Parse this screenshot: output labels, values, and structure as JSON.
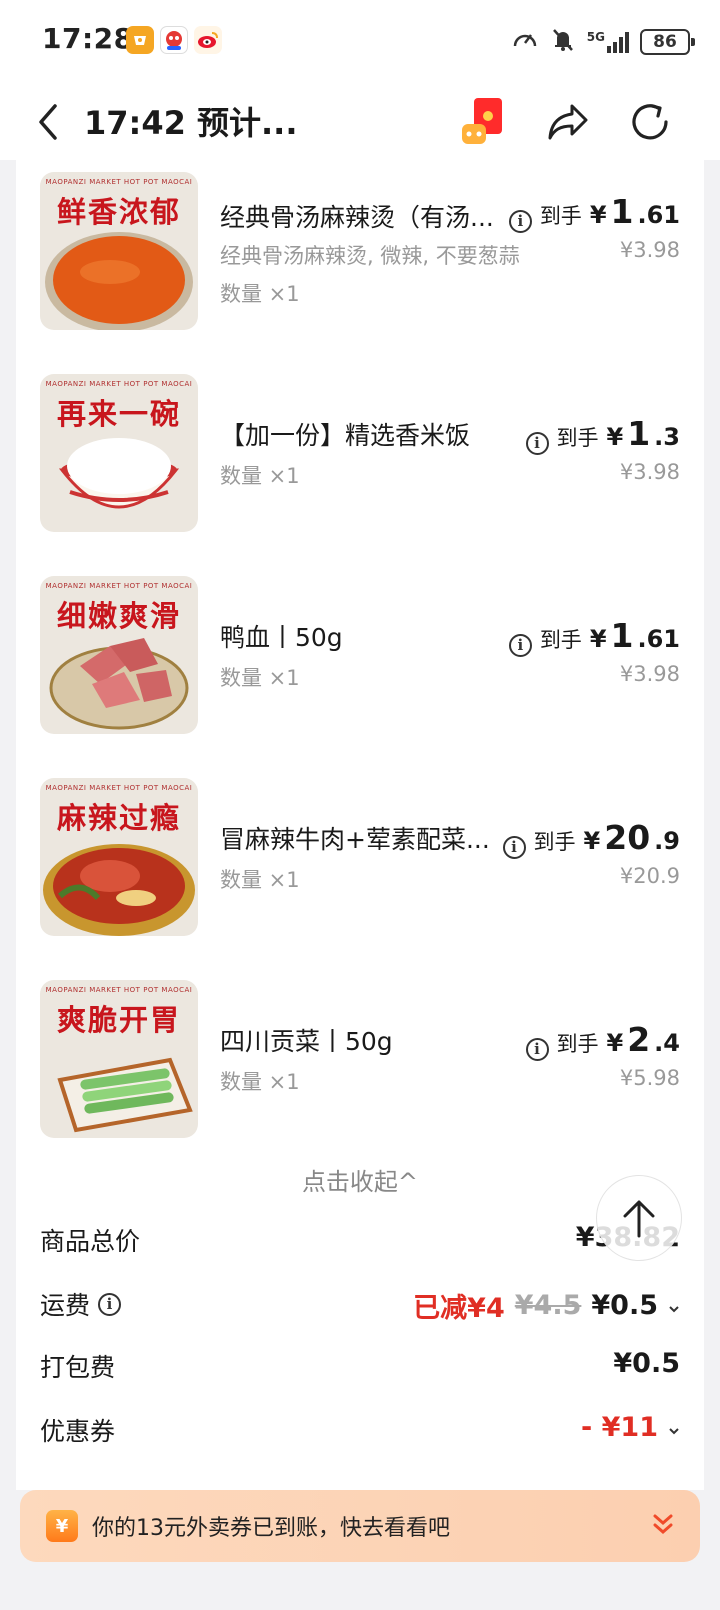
{
  "status_bar": {
    "time": "17:28",
    "network": "5G",
    "battery": "86"
  },
  "header": {
    "title": "17:42 预计..."
  },
  "items": [
    {
      "thumb_label": "鲜香浓郁",
      "name": "经典骨汤麻辣烫（有汤...",
      "spec": "经典骨汤麻辣烫, 微辣, 不要葱蒜",
      "qty": "数量 ×1",
      "arrival_label": "到手",
      "price_yen": "¥",
      "price_int": "1",
      "price_dec": ".61",
      "original_price": "¥3.98"
    },
    {
      "thumb_label": "再来一碗",
      "name": "【加一份】精选香米饭",
      "spec": "",
      "qty": "数量 ×1",
      "arrival_label": "到手",
      "price_yen": "¥",
      "price_int": "1",
      "price_dec": ".3",
      "original_price": "¥3.98"
    },
    {
      "thumb_label": "细嫩爽滑",
      "name": "鸭血丨50g",
      "spec": "",
      "qty": "数量 ×1",
      "arrival_label": "到手",
      "price_yen": "¥",
      "price_int": "1",
      "price_dec": ".61",
      "original_price": "¥3.98"
    },
    {
      "thumb_label": "麻辣过瘾",
      "name": "冒麻辣牛肉+荤素配菜...",
      "spec": "",
      "qty": "数量 ×1",
      "arrival_label": "到手",
      "price_yen": "¥",
      "price_int": "20",
      "price_dec": ".9",
      "original_price": "¥20.9"
    },
    {
      "thumb_label": "爽脆开胃",
      "name": "四川贡菜丨50g",
      "spec": "",
      "qty": "数量 ×1",
      "arrival_label": "到手",
      "price_yen": "¥",
      "price_int": "2",
      "price_dec": ".4",
      "original_price": "¥5.98"
    }
  ],
  "thumb_brand": "MAOPANZI MARKET HOT POT MAOCAI",
  "collapse_label": "点击收起^",
  "summary": {
    "goods_total_label": "商品总价",
    "goods_total_value": "¥38.82",
    "delivery_label": "运费",
    "delivery_discount": "已减¥4",
    "delivery_original": "¥4.5",
    "delivery_value": "¥0.5",
    "packing_label": "打包费",
    "packing_value": "¥0.5",
    "coupon_label": "优惠券",
    "coupon_value": "- ¥11"
  },
  "coupon_banner": {
    "icon": "¥",
    "text": "你的13元外卖券已到账，快去看看吧"
  },
  "colors": {
    "accent_red": "#e02e24",
    "banner_bg": "#fdd9bd",
    "thumb_label_red": "#c8161d"
  }
}
